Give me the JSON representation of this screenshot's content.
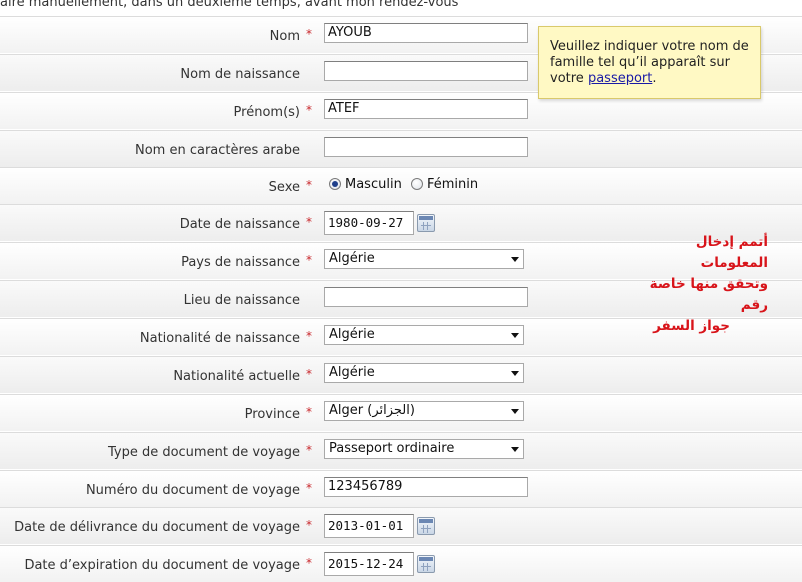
{
  "intro_text": "aire manuellement, dans un deuxième temps, avant mon rendez-vous",
  "colors": {
    "required": "#c8262b",
    "tooltip_bg": "#fff9c4",
    "annotation": "#d8141a"
  },
  "fields": {
    "nom": {
      "label": "Nom",
      "value": "AYOUB"
    },
    "nom_naissance": {
      "label": "Nom de naissance",
      "value": ""
    },
    "prenom": {
      "label": "Prénom(s)",
      "value": "ATEF"
    },
    "nom_arabe": {
      "label": "Nom en caractères arabe",
      "value": ""
    },
    "sexe": {
      "label": "Sexe",
      "option1": "Masculin",
      "option2": "Féminin",
      "selected": "Masculin"
    },
    "date_naissance": {
      "label": "Date de naissance",
      "value": "1980-09-27"
    },
    "pays_naissance": {
      "label": "Pays de naissance",
      "value": "Algérie"
    },
    "lieu_naissance": {
      "label": "Lieu de naissance",
      "value": ""
    },
    "nationalite_naissance": {
      "label": "Nationalité de naissance",
      "value": "Algérie"
    },
    "nationalite_actuelle": {
      "label": "Nationalité actuelle",
      "value": "Algérie"
    },
    "province": {
      "label": "Province",
      "value": "Alger (الجزائر)"
    },
    "type_document": {
      "label": "Type de document de voyage",
      "value": "Passeport ordinaire"
    },
    "numero_document": {
      "label": "Numéro du document de voyage",
      "value": "123456789"
    },
    "date_delivrance": {
      "label": "Date de délivrance du document de voyage",
      "value": "2013-01-01"
    },
    "date_expiration": {
      "label": "Date d’expiration du document de voyage",
      "value": "2015-12-24"
    }
  },
  "required_mark": "*",
  "tooltip": {
    "text_before": "Veuillez indiquer votre nom de famille tel qu’il apparaît sur votre",
    "link": "passeport",
    "text_after": "."
  },
  "annotation": {
    "line1": "أتمم إدخال المعلومات",
    "line2": "وتحقق منها خاصة رقم",
    "line3": "جواز السفر"
  }
}
